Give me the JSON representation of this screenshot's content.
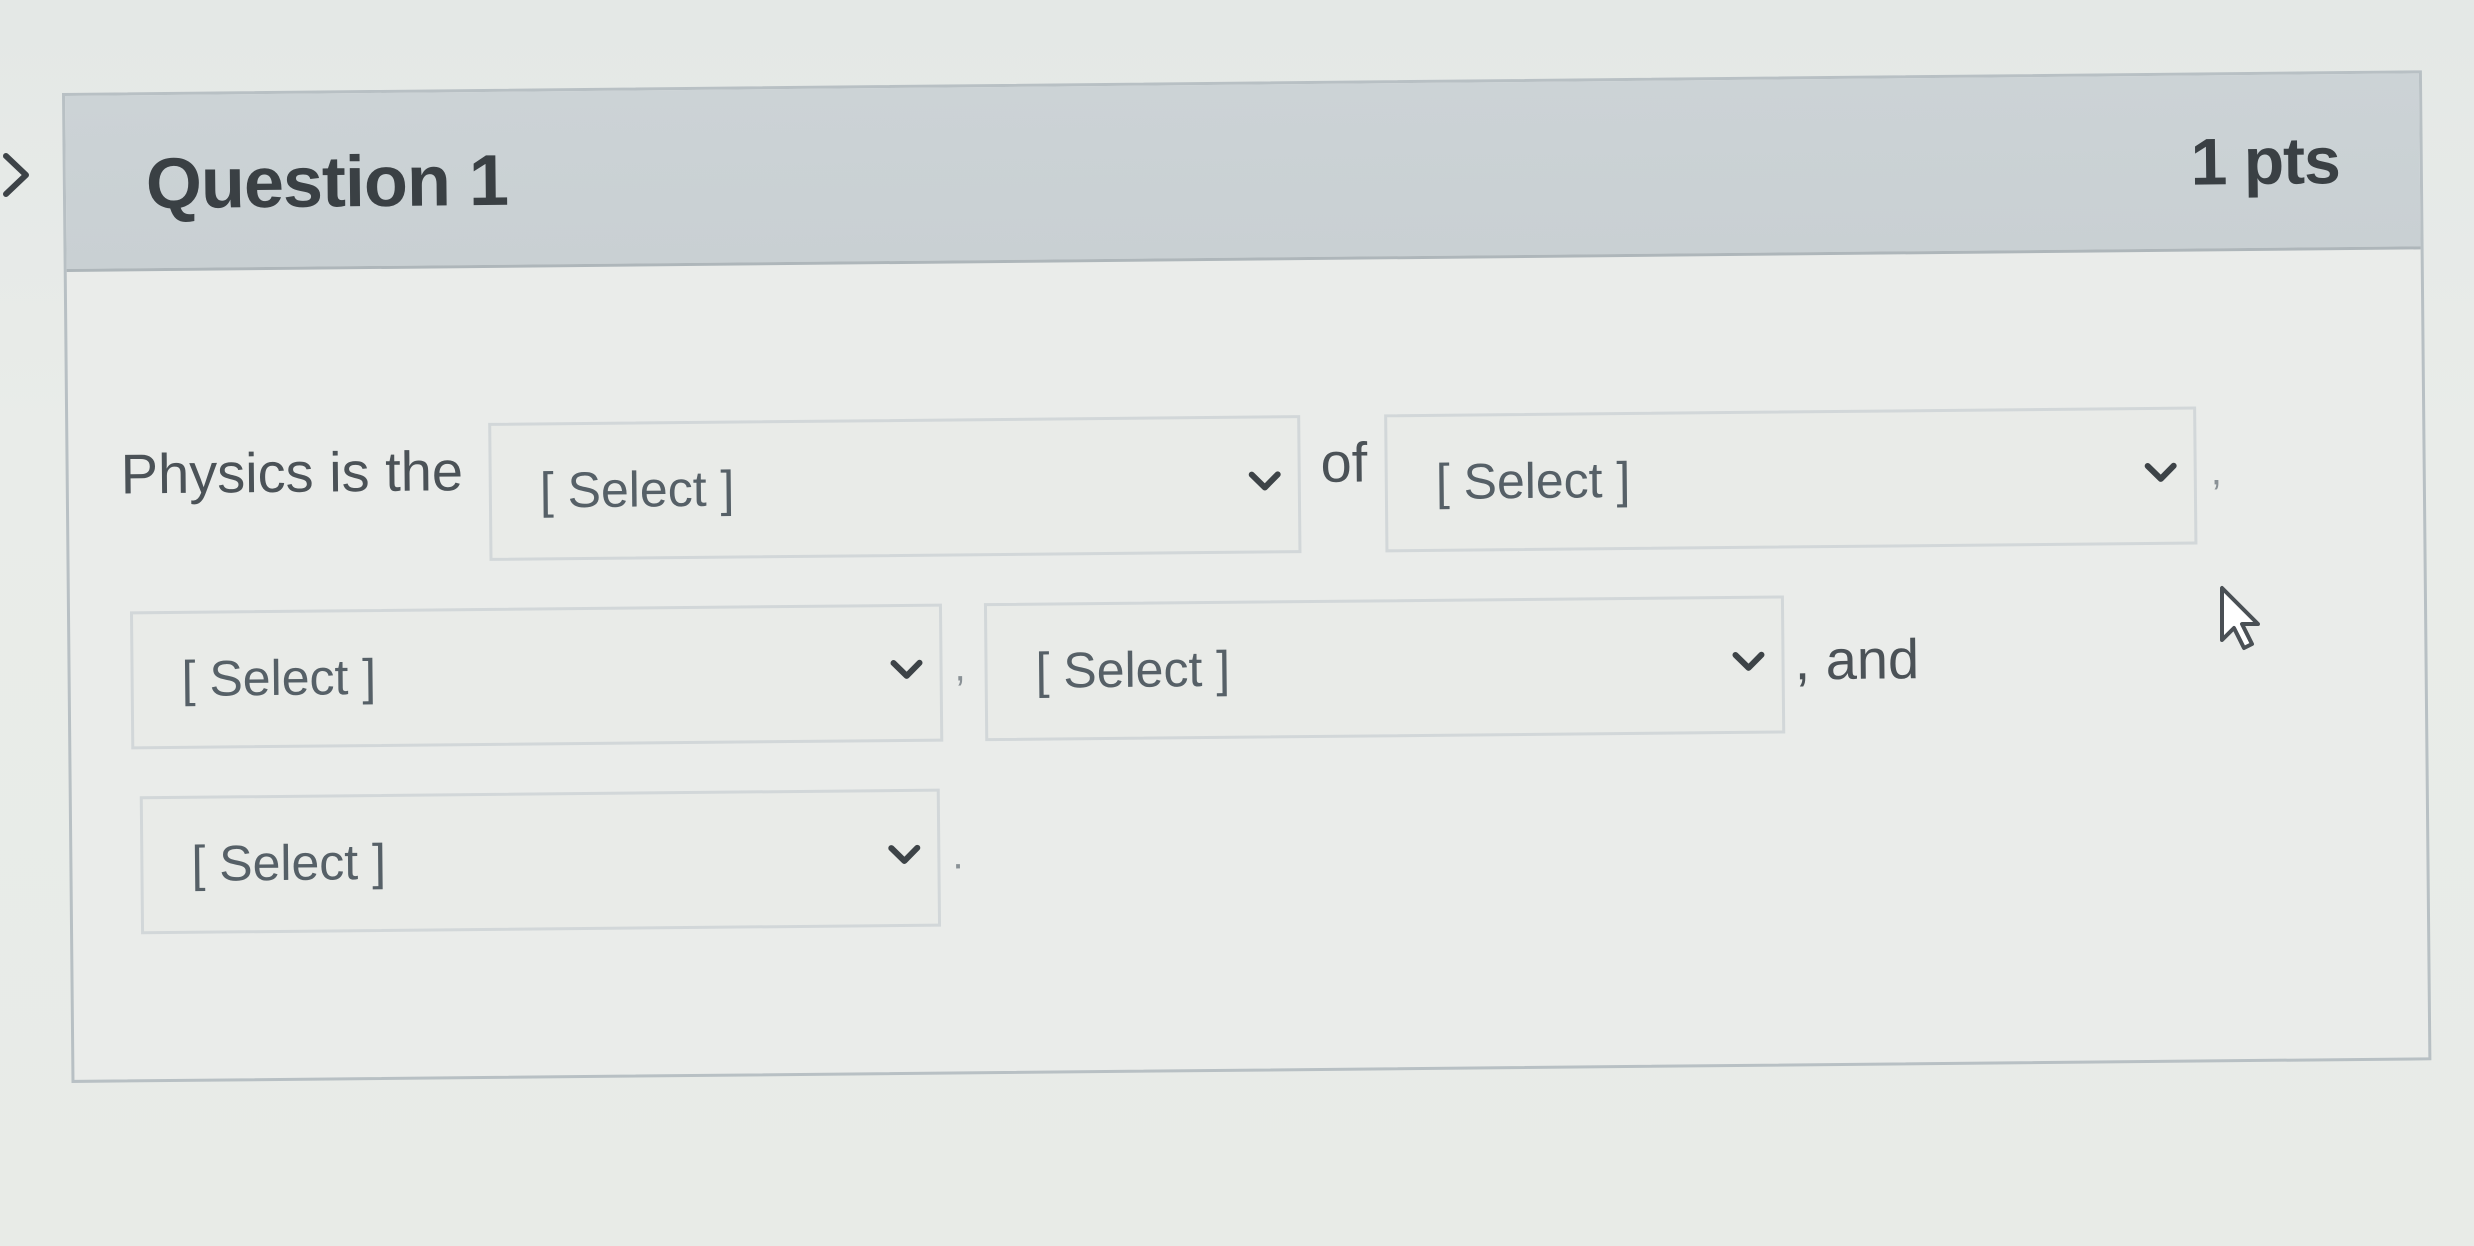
{
  "question": {
    "title": "Question 1",
    "points": "1 pts"
  },
  "sentence": {
    "prefix": "Physics is the",
    "of": "of",
    "comma": ",",
    "and": ", and",
    "period": "."
  },
  "dropdowns": [
    {
      "selected": "[ Select ]"
    },
    {
      "selected": "[ Select ]"
    },
    {
      "selected": "[ Select ]"
    },
    {
      "selected": "[ Select ]"
    },
    {
      "selected": "[ Select ]"
    }
  ],
  "icons": {
    "expand": "chevron-right-icon",
    "dropdown": "chevron-down-icon",
    "cursor": "mouse-pointer-icon"
  },
  "colors": {
    "header_background": "#cbd2d5",
    "page_background": "#e8ebe8",
    "text": "#4b5257"
  }
}
